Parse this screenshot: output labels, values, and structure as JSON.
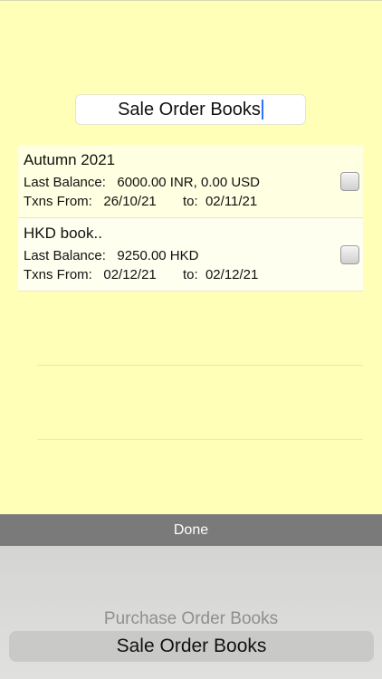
{
  "header": {
    "title_value": "Sale Order Books"
  },
  "books": [
    {
      "name": "Autumn 2021",
      "balance_label": "Last Balance:",
      "balance_value": "6000.00 INR, 0.00 USD",
      "from_label": "Txns From:",
      "from_value": "26/10/21",
      "to_label": "to:",
      "to_value": "02/11/21"
    },
    {
      "name": "HKD book..",
      "balance_label": "Last Balance:",
      "balance_value": "9250.00 HKD",
      "from_label": "Txns From:",
      "from_value": "02/12/21",
      "to_label": "to:",
      "to_value": "02/12/21"
    }
  ],
  "toolbar": {
    "done_label": "Done"
  },
  "picker": {
    "options": [
      "Purchase Order Books",
      "Sale Order Books"
    ],
    "selected": "Sale Order Books"
  },
  "colors": {
    "background": "#ffffb7",
    "toolbar": "#7a7a7a",
    "caret": "#2f6fff"
  }
}
